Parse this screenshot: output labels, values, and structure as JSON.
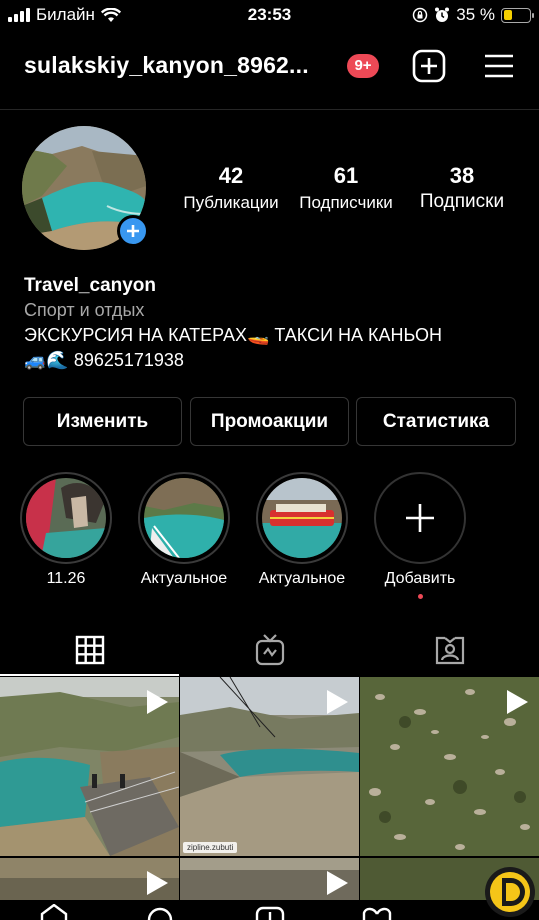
{
  "status_bar": {
    "carrier": "Билайн",
    "time": "23:53",
    "battery_percent": "35 %",
    "battery_level": 0.35,
    "icons": [
      "signal-icon",
      "wifi-icon",
      "rotation-lock-icon",
      "alarm-icon",
      "battery-icon"
    ]
  },
  "header": {
    "username": "sulakskiy_kanyon_8962...",
    "notification_badge": "9+",
    "icons": [
      "new-post-icon",
      "menu-icon"
    ]
  },
  "profile": {
    "stats": [
      {
        "value": "42",
        "label": "Публикации"
      },
      {
        "value": "61",
        "label": "Подписчики"
      },
      {
        "value": "38",
        "label": "Подписки"
      }
    ],
    "name": "Travel_canyon",
    "category": "Спорт и отдых",
    "bio_line1": "ЭКСКУРСИЯ НА КАТЕРАХ🚤 ТАКСИ НА КАНЬОН",
    "bio_line2": "🚙🌊 89625171938"
  },
  "actions": {
    "edit": "Изменить",
    "promo": "Промоакции",
    "stats": "Статистика"
  },
  "highlights": [
    {
      "label": "11.26"
    },
    {
      "label": "Актуальное"
    },
    {
      "label": "Актуальное"
    },
    {
      "label": "Добавить"
    }
  ],
  "tabs": [
    {
      "name": "grid-icon",
      "active": true
    },
    {
      "name": "igtv-icon",
      "active": false
    },
    {
      "name": "tagged-icon",
      "active": false
    }
  ],
  "grid": {
    "watermark": "zipline.zubuti"
  },
  "colors": {
    "accent_blue": "#3897f0",
    "badge_red": "#ed4956",
    "battery_yellow": "#f5d000"
  }
}
